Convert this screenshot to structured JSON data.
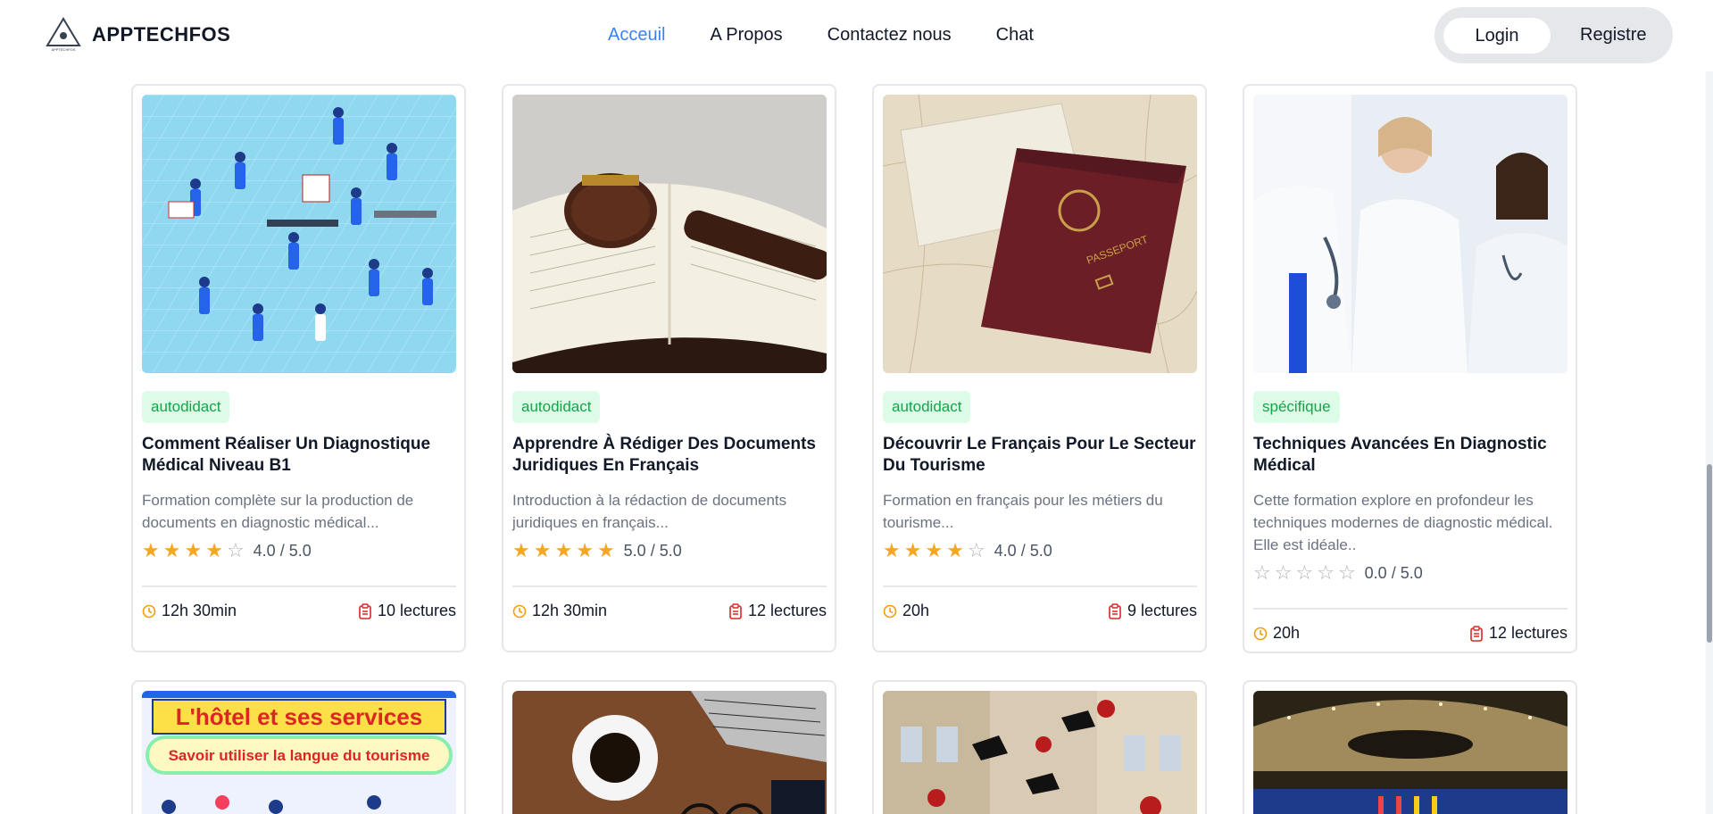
{
  "brand": {
    "name": "APPTECHFOS",
    "logo_text": "APPTECHFOS"
  },
  "nav": {
    "items": [
      {
        "label": "Acceuil",
        "active": true
      },
      {
        "label": "A Propos",
        "active": false
      },
      {
        "label": "Contactez nous",
        "active": false
      },
      {
        "label": "Chat",
        "active": false
      }
    ]
  },
  "auth": {
    "login_label": "Login",
    "register_label": "Registre"
  },
  "colors": {
    "accent": "#3b82f6",
    "tag_bg": "#dcfce7",
    "tag_text": "#16a34a",
    "star": "#f5a623",
    "meta_icon_time": "#f59e0b",
    "meta_icon_lectures": "#dc2626"
  },
  "cards": [
    {
      "image": "healthcare-staff-illustration",
      "tag": "autodidact",
      "title": "Comment Réaliser Un Diagnostique Médical Niveau B1",
      "description": "Formation complète sur la production de documents en diagnostic médical...",
      "rating": 4,
      "rating_text": "4.0 / 5.0",
      "duration": "12h 30min",
      "lectures": "10 lectures"
    },
    {
      "image": "gavel-on-book-photo",
      "tag": "autodidact",
      "title": "Apprendre À Rédiger Des Documents Juridiques En Français",
      "description": "Introduction à la rédaction de documents juridiques en français...",
      "rating": 5,
      "rating_text": "5.0 / 5.0",
      "duration": "12h 30min",
      "lectures": "12 lectures"
    },
    {
      "image": "passport-on-map-photo",
      "tag": "autodidact",
      "title": "Découvrir Le Français Pour Le Secteur Du Tourisme",
      "description": "Formation en français pour les métiers du tourisme...",
      "rating": 4,
      "rating_text": "4.0 / 5.0",
      "duration": "20h",
      "lectures": "9 lectures"
    },
    {
      "image": "medical-doctors-photo",
      "tag": "spécifique",
      "title": "Techniques Avancées En Diagnostic Médical",
      "description": "Cette formation explore en profondeur les techniques modernes de diagnostic médical. Elle est idéale..",
      "rating": 0,
      "rating_text": "0.0 / 5.0",
      "duration": "20h",
      "lectures": "12 lectures"
    }
  ],
  "next_row": [
    {
      "image": "hotel-services-banner",
      "banner_title": "L'hôtel et ses services",
      "banner_subtitle": "Savoir utiliser la langue du tourisme"
    },
    {
      "image": "coffee-laptop-desk-photo"
    },
    {
      "image": "graduation-caps-photo"
    },
    {
      "image": "parliament-hall-photo"
    }
  ]
}
